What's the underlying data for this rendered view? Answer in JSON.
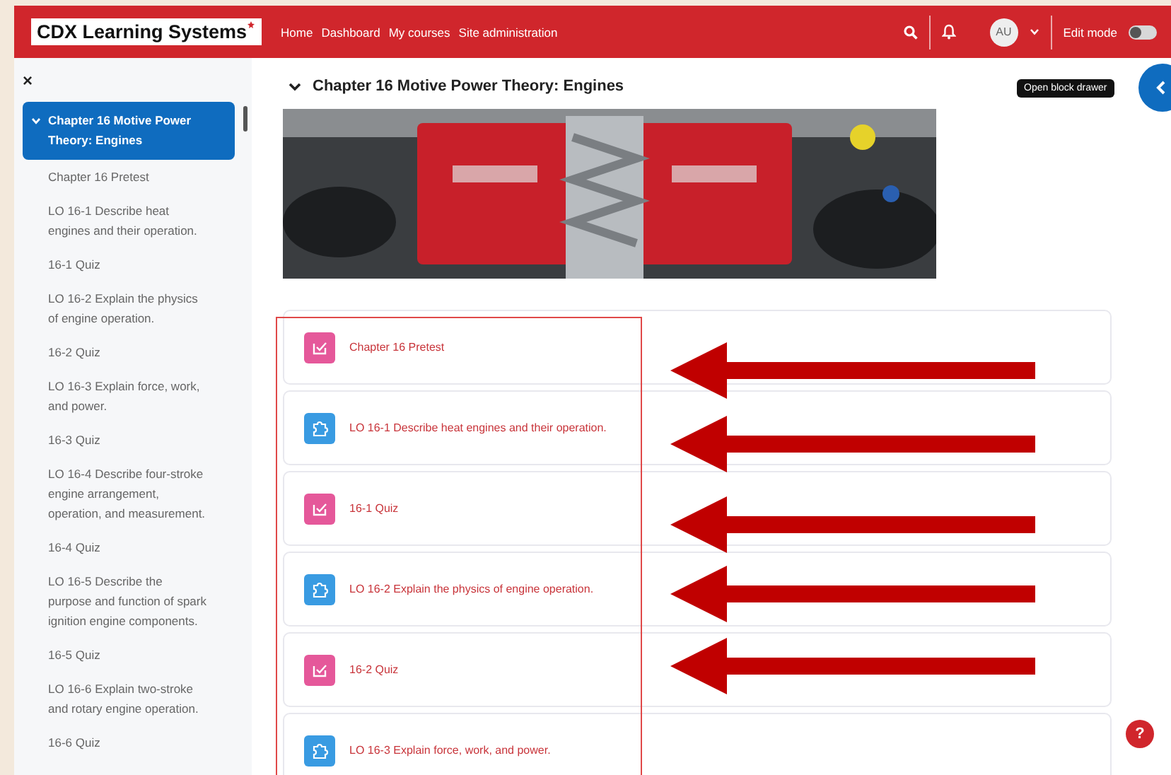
{
  "navbar": {
    "logo": "CDX Learning Systems",
    "links": [
      {
        "label": "Home"
      },
      {
        "label": "Dashboard"
      },
      {
        "label": "My courses"
      },
      {
        "label": "Site administration"
      }
    ],
    "avatar": "AU",
    "edit_mode": {
      "label": "Edit mode",
      "on": false
    }
  },
  "sidebar": {
    "close": "×",
    "sections": [
      {
        "title": "Chapter 16 Motive Power Theory: Engines",
        "selected": true,
        "expanded": true,
        "children": [
          {
            "label": "Chapter 16 Pretest"
          },
          {
            "label": "LO 16-1 Describe heat engines and their operation."
          },
          {
            "label": "16-1 Quiz"
          },
          {
            "label": "LO 16-2 Explain the physics of engine operation."
          },
          {
            "label": "16-2 Quiz"
          },
          {
            "label": "LO 16-3 Explain force, work, and power."
          },
          {
            "label": "16-3 Quiz"
          },
          {
            "label": "LO 16-4 Describe four-stroke engine arrangement, operation, and measurement."
          },
          {
            "label": "16-4 Quiz"
          },
          {
            "label": "LO 16-5 Describe the purpose and function of spark ignition engine components."
          },
          {
            "label": "16-5 Quiz"
          },
          {
            "label": "LO 16-6 Explain two-stroke and rotary engine operation."
          },
          {
            "label": "16-6 Quiz"
          }
        ]
      }
    ]
  },
  "section": {
    "title": "Chapter 16 Motive Power Theory: Engines",
    "expanded": true,
    "activities": [
      {
        "kind": "quiz",
        "title": "Chapter 16 Pretest"
      },
      {
        "kind": "page",
        "title": "LO 16-1 Describe heat engines and their operation."
      },
      {
        "kind": "quiz",
        "title": "16-1 Quiz"
      },
      {
        "kind": "page",
        "title": "LO 16-2 Explain the physics of engine operation."
      },
      {
        "kind": "quiz",
        "title": "16-2 Quiz"
      },
      {
        "kind": "page",
        "title": "LO 16-3 Explain force, work, and power."
      }
    ]
  },
  "block_drawer": {
    "tooltip": "Open block drawer"
  },
  "help": {
    "label": "?"
  }
}
